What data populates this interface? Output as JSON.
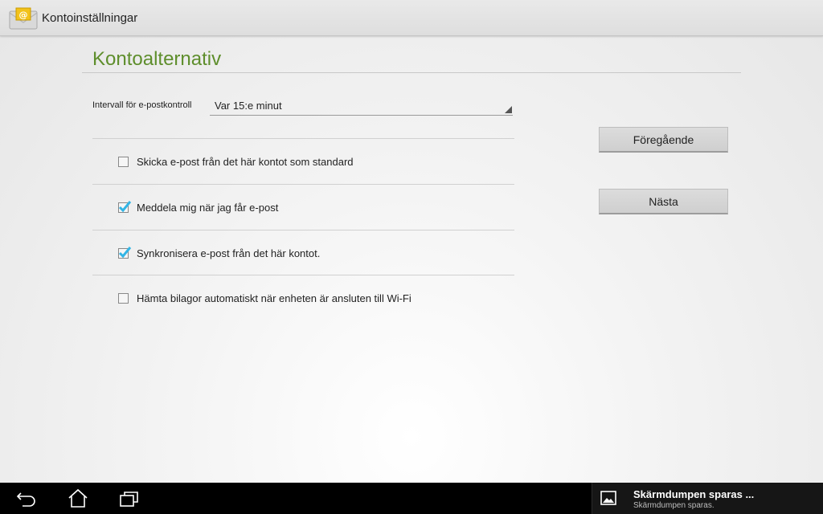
{
  "action_bar": {
    "title": "Kontoinställningar",
    "icon": "email-app-icon"
  },
  "section": {
    "title": "Kontoalternativ"
  },
  "interval": {
    "label": "Intervall för e-postkontroll",
    "value": "Var 15:e minut"
  },
  "options": [
    {
      "label": "Skicka e-post från det här kontot som standard",
      "checked": false
    },
    {
      "label": "Meddela mig när jag får e-post",
      "checked": true
    },
    {
      "label": "Synkronisera e-post från det här kontot.",
      "checked": true
    },
    {
      "label": "Hämta bilagor automatiskt när enheten är ansluten till Wi-Fi",
      "checked": false
    }
  ],
  "buttons": {
    "previous": "Föregående",
    "next": "Nästa"
  },
  "nav_bar": {
    "back_icon": "back-icon",
    "home_icon": "home-icon",
    "recents_icon": "recent-apps-icon"
  },
  "notification": {
    "icon": "image-icon",
    "title": "Skärmdumpen sparas ...",
    "subtitle": "Skärmdumpen sparas."
  },
  "colors": {
    "section_title": "#5e8e2c",
    "checkmark": "#33b5e5",
    "nav_bar": "#000000"
  }
}
